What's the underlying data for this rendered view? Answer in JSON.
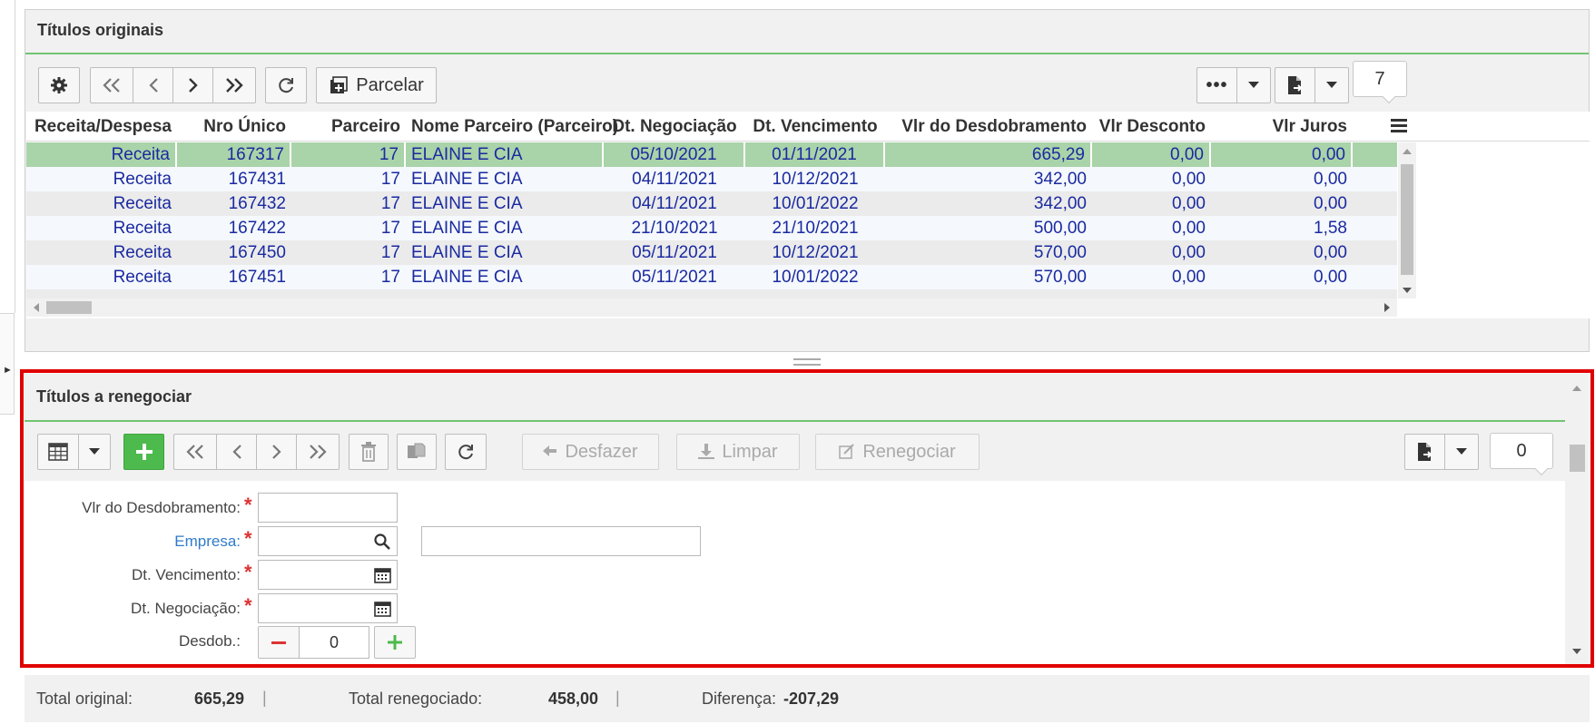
{
  "top_panel": {
    "title": "Títulos originais",
    "toolbar": {
      "parcelar_label": "Parcelar",
      "record_count": "7"
    },
    "columns": [
      "Receita/Despesa",
      "Nro Único",
      "Parceiro",
      "Nome Parceiro (Parceiro)",
      "Dt. Negociação",
      "Dt. Vencimento",
      "Vlr do Desdobramento",
      "Vlr Desconto",
      "Vlr Juros"
    ],
    "rows": [
      [
        "Receita",
        "167317",
        "17",
        "ELAINE E CIA",
        "05/10/2021",
        "01/11/2021",
        "665,29",
        "0,00",
        "0,00"
      ],
      [
        "Receita",
        "167431",
        "17",
        "ELAINE E CIA",
        "04/11/2021",
        "10/12/2021",
        "342,00",
        "0,00",
        "0,00"
      ],
      [
        "Receita",
        "167432",
        "17",
        "ELAINE E CIA",
        "04/11/2021",
        "10/01/2022",
        "342,00",
        "0,00",
        "0,00"
      ],
      [
        "Receita",
        "167422",
        "17",
        "ELAINE E CIA",
        "21/10/2021",
        "21/10/2021",
        "500,00",
        "0,00",
        "1,58"
      ],
      [
        "Receita",
        "167450",
        "17",
        "ELAINE E CIA",
        "05/11/2021",
        "10/12/2021",
        "570,00",
        "0,00",
        "0,00"
      ],
      [
        "Receita",
        "167451",
        "17",
        "ELAINE E CIA",
        "05/11/2021",
        "10/01/2022",
        "570,00",
        "0,00",
        "0,00"
      ]
    ]
  },
  "bottom_panel": {
    "title": "Títulos a renegociar",
    "toolbar": {
      "desfazer_label": "Desfazer",
      "limpar_label": "Limpar",
      "renegociar_label": "Renegociar",
      "record_count": "0"
    },
    "form": {
      "vlr_desdobramento_label": "Vlr do Desdobramento:",
      "empresa_label": "Empresa:",
      "dt_vencimento_label": "Dt. Vencimento:",
      "dt_negociacao_label": "Dt. Negociação:",
      "desdob_label": "Desdob.:",
      "desdob_value": "0"
    }
  },
  "summary": {
    "total_original_label": "Total original:",
    "total_original_value": "665,29",
    "total_renegociado_label": "Total renegociado:",
    "total_renegociado_value": "458,00",
    "diferenca_label": "Diferença:",
    "diferenca_value": "-207,29"
  },
  "colors": {
    "accent_green": "#72c472",
    "selected_row": "#a9d3a9",
    "highlight_border": "#e00000",
    "link_text": "#1a2aa0"
  }
}
